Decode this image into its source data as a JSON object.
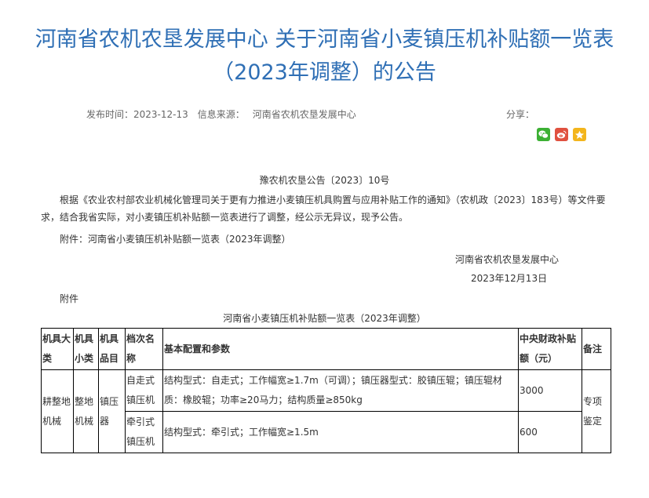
{
  "article": {
    "title_line1": "河南省农机农垦发展中心 关于河南省小麦镇压机补贴额一览表",
    "title_line2": "（2023年调整）的公告",
    "publish_label": "发布时间：",
    "publish_date": "2023-12-13",
    "source_label": "信息来源：",
    "source": "河南省农机农垦发展中心",
    "share_label": "分享："
  },
  "share_icons": [
    {
      "name": "wechat-icon",
      "color": "#3cb034"
    },
    {
      "name": "weibo-icon",
      "color": "#e0513f"
    },
    {
      "name": "qzone-icon",
      "color": "#f3b51c"
    }
  ],
  "body": {
    "doc_number": "豫农机农垦公告〔2023〕10号",
    "paragraph1": "根据《农业农村部农业机械化管理司关于更有力推进小麦镇压机具购置与应用补贴工作的通知》（农机政〔2023〕183号）等文件要求，结合我省实际，对小麦镇压机补贴额一览表进行了调整，经公示无异议，现予公告。",
    "paragraph2": "附件：河南省小麦镇压机补贴额一览表（2023年调整）",
    "sign_org": "河南省农机农垦发展中心",
    "sign_date": "2023年12月13日",
    "attachment_label": "附件",
    "table_title": "河南省小麦镇压机补贴额一览表（2023年调整）"
  },
  "table": {
    "headers": [
      "机具大类",
      "机具小类",
      "机具品目",
      "档次名称",
      "基本配置和参数",
      "中央财政补贴额（元）",
      "备注"
    ],
    "category": "耕整地机械",
    "subcategory": "整地机械",
    "item": "镇压器",
    "rows": [
      {
        "tier": "自走式镇压机",
        "config": "结构型式：自走式；工作幅宽≥1.7m（可调）；镇压器型式：胶镇压辊；镇压辊材质：橡胶辊；功率≥20马力；结构质量≥850kg",
        "subsidy": "3000"
      },
      {
        "tier": "牵引式镇压机",
        "config": "结构型式：牵引式；工作幅宽≥1.5m",
        "subsidy": "600"
      }
    ],
    "remark": "专项鉴定"
  }
}
